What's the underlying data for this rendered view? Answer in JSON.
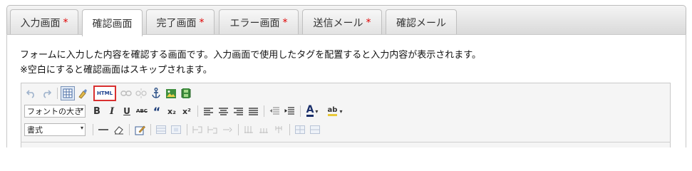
{
  "tabs": [
    {
      "label": "入力画面",
      "star": "*",
      "active": false
    },
    {
      "label": "確認画面",
      "star": "",
      "active": true
    },
    {
      "label": "完了画面",
      "star": "*",
      "active": false
    },
    {
      "label": "エラー画面",
      "star": "*",
      "active": false
    },
    {
      "label": "送信メール",
      "star": "*",
      "active": false
    },
    {
      "label": "確認メール",
      "star": "",
      "active": false
    }
  ],
  "description": {
    "line1": "フォームに入力した内容を確認する画面です。入力画面で使用したタグを配置すると入力内容が表示されます。",
    "line2": "※空白にすると確認画面はスキップされます。"
  },
  "toolbar": {
    "html_label": "HTML",
    "font_size_select": "フォントの大き",
    "format_select": "書式",
    "bold": "B",
    "italic": "I",
    "underline": "U",
    "strike": "ABC",
    "quote": "“",
    "subscript": "x₂",
    "superscript": "x²",
    "font_color": "A",
    "highlight": "ab"
  },
  "colors": {
    "required_star": "#e00000",
    "html_button_border": "#d93030"
  }
}
